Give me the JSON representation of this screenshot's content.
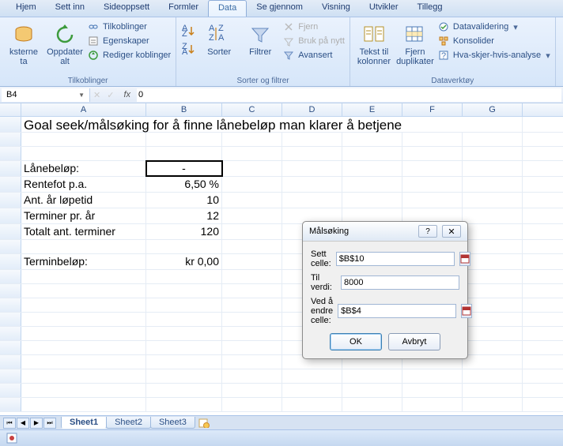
{
  "tabs": [
    "Hjem",
    "Sett inn",
    "Sideoppsett",
    "Formler",
    "Data",
    "Se gjennom",
    "Visning",
    "Utvikler",
    "Tillegg"
  ],
  "active_tab": "Data",
  "ribbon": {
    "g1": {
      "btn1": "ksterne\nta",
      "btn2": "Oppdater\nalt",
      "items": [
        "Tilkoblinger",
        "Egenskaper",
        "Rediger koblinger"
      ],
      "label": "Tilkoblinger"
    },
    "g2": {
      "sort": "Sorter",
      "filter": "Filtrer",
      "items": [
        "Fjern",
        "Bruk på nytt",
        "Avansert"
      ],
      "label": "Sorter og filtrer"
    },
    "g3": {
      "btn1": "Tekst til\nkolonner",
      "btn2": "Fjern\nduplikater",
      "items": [
        "Datavalidering",
        "Konsolider",
        "Hva-skjer-hvis-analyse"
      ],
      "label": "Dataverktøy"
    }
  },
  "namebox": "B4",
  "formula": "0",
  "cols": [
    "A",
    "B",
    "C",
    "D",
    "E",
    "F",
    "G"
  ],
  "cells": {
    "title": "Goal seek/målsøking for å finne lånebeløp man klarer å betjene",
    "r4a": "Lånebeløp:",
    "r4b": "-",
    "r5a": "Rentefot p.a.",
    "r5b": "6,50 %",
    "r6a": "Ant. år løpetid",
    "r6b": "10",
    "r7a": "Terminer pr. år",
    "r7b": "12",
    "r8a": "Totalt ant. terminer",
    "r8b": "120",
    "r10a": "Terminbeløp:",
    "r10b": "kr 0,00"
  },
  "dialog": {
    "title": "Målsøking",
    "set_cell_label": "Sett celle:",
    "set_cell": "$B$10",
    "to_value_label": "Til verdi:",
    "to_value": "8000",
    "by_changing_label": "Ved å endre celle:",
    "by_changing": "$B$4",
    "ok": "OK",
    "cancel": "Avbryt"
  },
  "sheets": [
    "Sheet1",
    "Sheet2",
    "Sheet3"
  ]
}
